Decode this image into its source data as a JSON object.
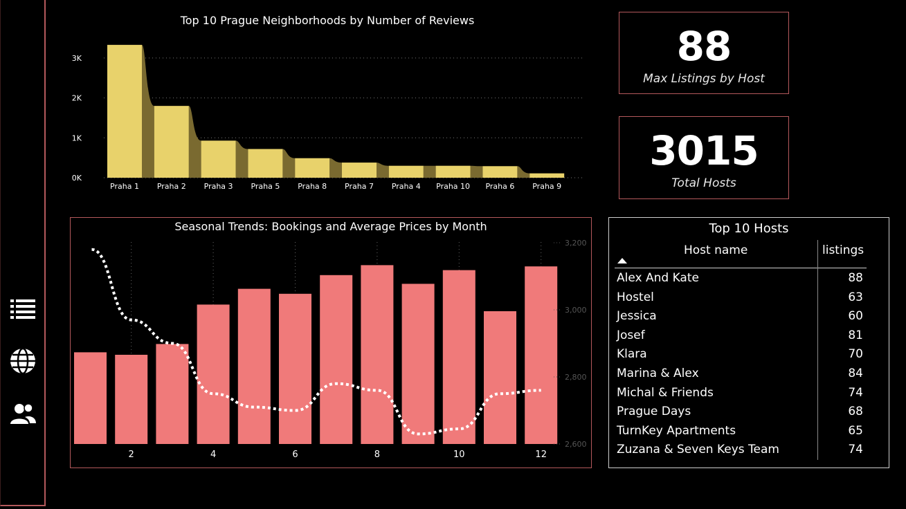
{
  "nav": {
    "items": [
      {
        "icon": "list-icon"
      },
      {
        "icon": "globe-icon"
      },
      {
        "icon": "users-icon"
      }
    ]
  },
  "kpis": [
    {
      "value": "88",
      "label": "Max Listings by Host"
    },
    {
      "value": "3015",
      "label": "Total Hosts"
    }
  ],
  "colors": {
    "bar_yellow": "#e8d26b",
    "bar_yellow_shadow": "#7a6a30",
    "bar_pink": "#f07a7a",
    "border": "#b5595c",
    "background": "#000000"
  },
  "reviews_chart": {
    "title": "Top 10 Prague Neighborhoods by Number of Reviews"
  },
  "seasonal_chart": {
    "title": "Seasonal Trends: Bookings and Average Prices by Month"
  },
  "hosts_table": {
    "title": "Top 10 Hosts",
    "col_name": "Host name",
    "col_listings": "listings",
    "rows": [
      {
        "name": "Alex And Kate",
        "listings": "88"
      },
      {
        "name": "Hostel",
        "listings": "63"
      },
      {
        "name": "Jessica",
        "listings": "60"
      },
      {
        "name": "Josef",
        "listings": "81"
      },
      {
        "name": "Klara",
        "listings": "70"
      },
      {
        "name": "Marina & Alex",
        "listings": "84"
      },
      {
        "name": "Michal & Friends",
        "listings": "74"
      },
      {
        "name": "Prague Days",
        "listings": "68"
      },
      {
        "name": "TurnKey Apartments",
        "listings": "65"
      },
      {
        "name": "Zuzana & Seven Keys Team",
        "listings": "74"
      }
    ]
  },
  "chart_data": [
    {
      "type": "bar",
      "title": "Top 10 Prague Neighborhoods by Number of Reviews",
      "categories": [
        "Praha 1",
        "Praha 2",
        "Praha 3",
        "Praha 5",
        "Praha 8",
        "Praha 7",
        "Praha 4",
        "Praha 10",
        "Praha 6",
        "Praha 9"
      ],
      "values": [
        3330,
        1800,
        930,
        720,
        490,
        380,
        300,
        300,
        290,
        110
      ],
      "ylim": [
        0,
        3000
      ],
      "yticks": [
        0,
        1000,
        2000,
        3000
      ],
      "ytick_labels": [
        "0K",
        "1K",
        "2K",
        "3K"
      ],
      "grid": true
    },
    {
      "type": "bar",
      "title": "Seasonal Trends: Bookings and Average Prices by Month",
      "x": [
        1,
        2,
        3,
        4,
        5,
        6,
        7,
        8,
        9,
        10,
        11,
        12
      ],
      "xtick_labels": [
        "2",
        "4",
        "6",
        "8",
        "10",
        "12"
      ],
      "series": [
        {
          "type": "bar",
          "values": [
            2210,
            2150,
            2410,
            3360,
            3740,
            3620,
            4070,
            4310,
            3860,
            4190,
            3200,
            4280
          ]
        },
        {
          "type": "line",
          "style": "dotted",
          "values": [
            3180,
            2970,
            2900,
            2750,
            2710,
            2700,
            2780,
            2760,
            2630,
            2645,
            2750,
            2760
          ]
        }
      ],
      "y2lim": [
        2600,
        3200
      ],
      "y2ticks": [
        "2,600",
        "2,800",
        "3,000",
        "3,200"
      ]
    }
  ]
}
